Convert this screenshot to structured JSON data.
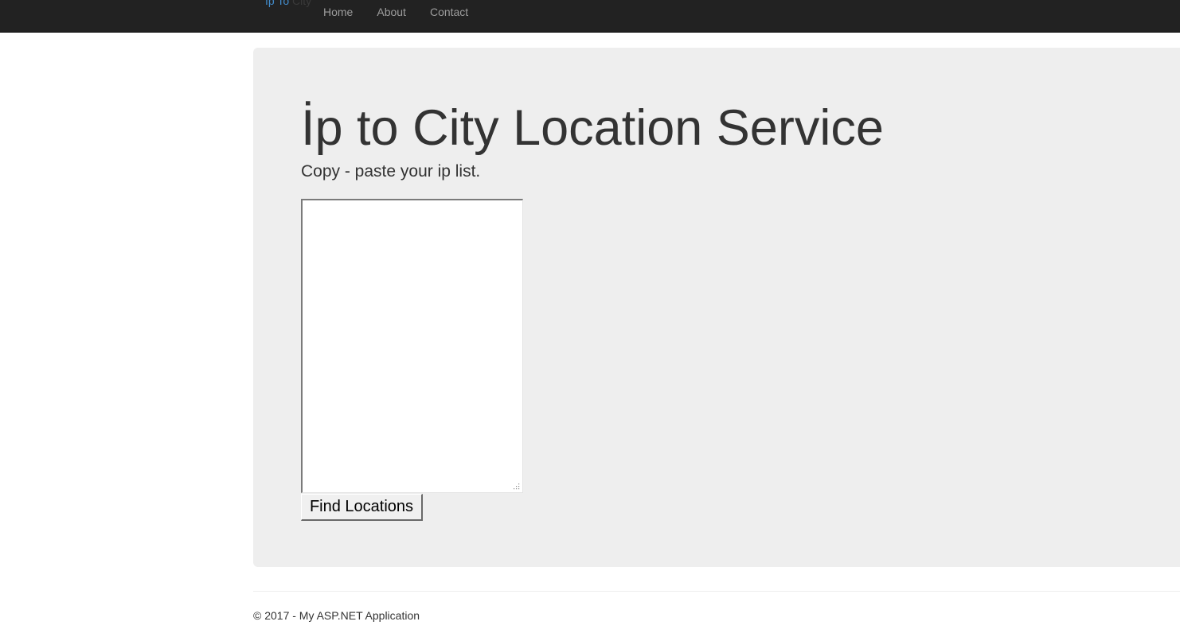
{
  "navbar": {
    "brand_part1": "İp To",
    "brand_part2": "City",
    "links": [
      {
        "label": "Home"
      },
      {
        "label": "About"
      },
      {
        "label": "Contact"
      }
    ]
  },
  "main": {
    "title": "İp to City Location Service",
    "lead": "Copy - paste your ip list.",
    "ip_list_value": "",
    "submit_label": "Find Locations"
  },
  "footer": {
    "text": "© 2017 - My ASP.NET Application"
  },
  "colors": {
    "navbar_bg": "#222222",
    "nav_link": "#9d9d9d",
    "brand_accent": "#428bca",
    "jumbotron_bg": "#eeeeee",
    "text": "#333333"
  },
  "icons": {
    "textarea_resize": "resize-grip-icon"
  }
}
